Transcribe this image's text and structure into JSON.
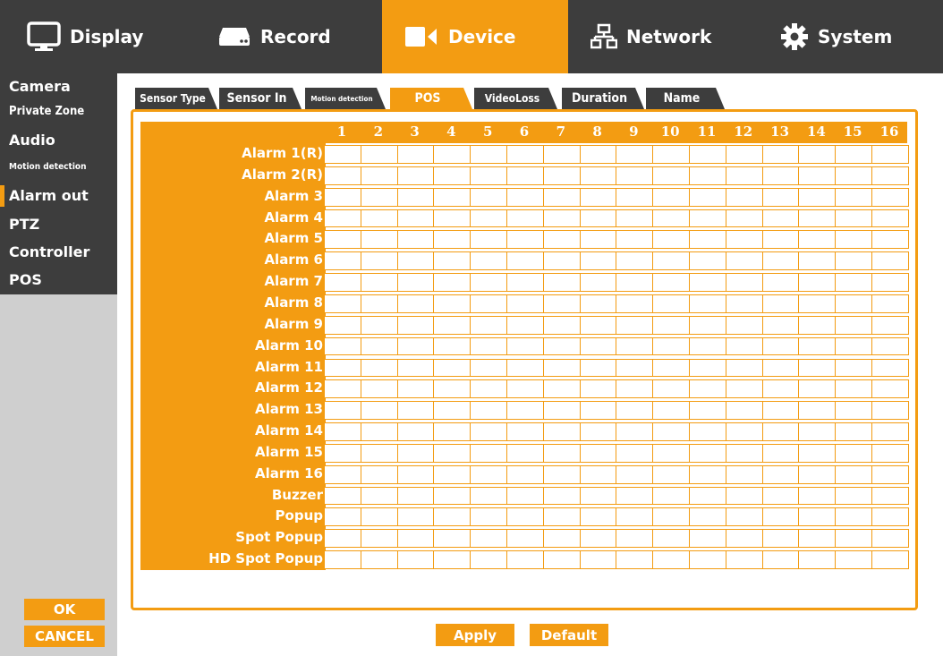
{
  "top_tabs": [
    {
      "label": "Display",
      "icon": "monitor-icon"
    },
    {
      "label": "Record",
      "icon": "hard-drive-icon"
    },
    {
      "label": "Device",
      "icon": "camera-icon",
      "active": true
    },
    {
      "label": "Network",
      "icon": "network-icon"
    },
    {
      "label": "System",
      "icon": "gear-icon"
    }
  ],
  "sidebar": {
    "items": [
      "Camera",
      "Private Zone",
      "Audio",
      "Motion detection",
      "Alarm out",
      "PTZ",
      "Controller",
      "POS"
    ],
    "selected": "Alarm out",
    "ok_label": "OK",
    "cancel_label": "CANCEL"
  },
  "subtabs": {
    "items": [
      "Sensor Type",
      "Sensor In",
      "Motion detection",
      "POS",
      "VideoLoss",
      "Duration",
      "Name"
    ],
    "active": "POS"
  },
  "grid": {
    "columns": [
      "1",
      "2",
      "3",
      "4",
      "5",
      "6",
      "7",
      "8",
      "9",
      "10",
      "11",
      "12",
      "13",
      "14",
      "15",
      "16"
    ],
    "rows": [
      "Alarm 1(R)",
      "Alarm 2(R)",
      "Alarm 3",
      "Alarm 4",
      "Alarm 5",
      "Alarm 6",
      "Alarm 7",
      "Alarm 8",
      "Alarm 9",
      "Alarm 10",
      "Alarm 11",
      "Alarm 12",
      "Alarm 13",
      "Alarm 14",
      "Alarm 15",
      "Alarm 16",
      "Buzzer",
      "Popup",
      "Spot Popup",
      "HD Spot Popup"
    ]
  },
  "actions": {
    "apply_label": "Apply",
    "default_label": "Default"
  },
  "colors": {
    "accent": "#f39c12",
    "dark": "#3d3d3d",
    "sidebar_bg": "#cfcfcf"
  }
}
